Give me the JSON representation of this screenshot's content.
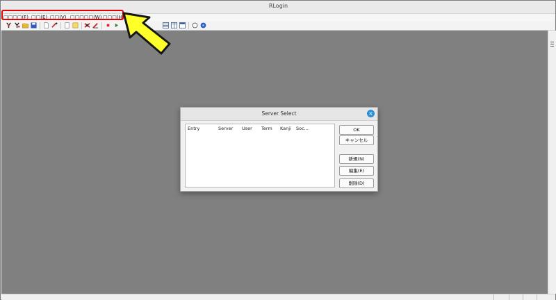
{
  "window": {
    "title": "RLogin"
  },
  "menu": [
    {
      "label": "□□□□(F)"
    },
    {
      "label": "□□(E)"
    },
    {
      "label": "□□(V)"
    },
    {
      "label": "□□□□□(W)"
    },
    {
      "label": "□□□(H)"
    }
  ],
  "toolbar_icons": [
    "connect-icon",
    "disconnect-icon",
    "open-folder-icon",
    "save-icon",
    "new-document-icon",
    "paste-icon",
    "copy-icon",
    "note-icon",
    "server-select-icon",
    "edit-icon",
    "stop-icon",
    "play-icon",
    "window-list-icon",
    "window-split-icon",
    "window-cascade-icon",
    "settings-circle-icon",
    "help-icon"
  ],
  "dialog": {
    "title": "Server Select",
    "columns": [
      "Entry",
      "Server",
      "User",
      "Term",
      "Kanji",
      "Soc..."
    ],
    "rows": [],
    "buttons": {
      "ok": "OK",
      "cancel": "キャンセル",
      "new": "新規(N)",
      "edit": "編集(E)",
      "delete": "削除(D)"
    }
  },
  "colors": {
    "workspace": "#808080",
    "annotation_border": "#e10000",
    "arrow_fill": "#ffff2a",
    "close_button": "#2a8fd6"
  }
}
